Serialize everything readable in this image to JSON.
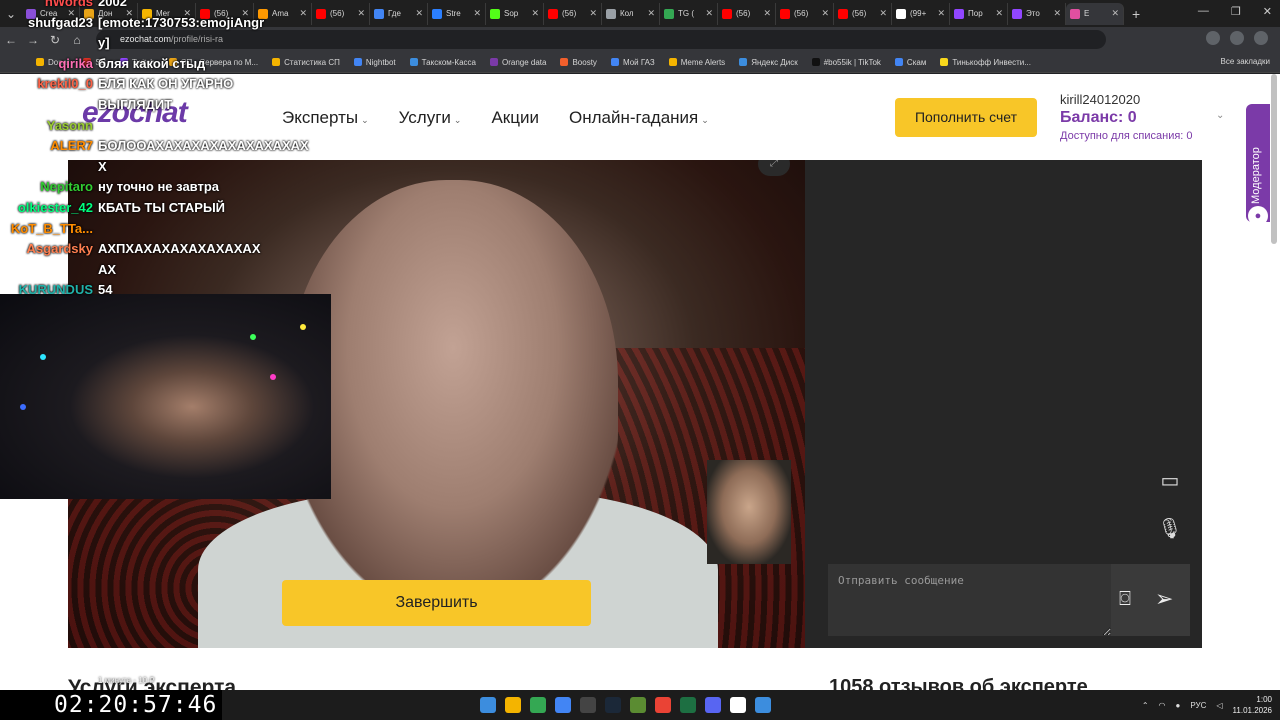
{
  "browser": {
    "tabs": [
      {
        "label": "Crea",
        "color": "#8a4fd8"
      },
      {
        "label": "Дон",
        "color": "#e8a317"
      },
      {
        "label": "Mer",
        "color": "#f4b400"
      },
      {
        "label": "(56)",
        "color": "#ff0000"
      },
      {
        "label": "Ama",
        "color": "#ff9900"
      },
      {
        "label": "(56)",
        "color": "#ff0000"
      },
      {
        "label": "Где",
        "color": "#4285f4"
      },
      {
        "label": "Stre",
        "color": "#2b7fff"
      },
      {
        "label": "Sop",
        "color": "#53fc18"
      },
      {
        "label": "(56)",
        "color": "#ff0000"
      },
      {
        "label": "Кол",
        "color": "#9aa0a6"
      },
      {
        "label": "TG (",
        "color": "#34a853"
      },
      {
        "label": "(56)",
        "color": "#ff0000"
      },
      {
        "label": "(56)",
        "color": "#ff0000"
      },
      {
        "label": "(56)",
        "color": "#ff0000"
      },
      {
        "label": "(99+",
        "color": "#ffffff"
      },
      {
        "label": "Пор",
        "color": "#9146ff"
      },
      {
        "label": "Это",
        "color": "#9146ff"
      },
      {
        "label": "E",
        "color": "#e04fa0"
      }
    ],
    "url_host": "ezochat.com",
    "url_path": "/profile/risi-ra",
    "bookmarks": [
      {
        "label": "Donat",
        "color": "#f4b400"
      },
      {
        "label": "SB",
        "color": "#d93025"
      },
      {
        "label": "Twitch",
        "color": "#9146ff"
      },
      {
        "label": "СП - Сервера по М...",
        "color": "#e8a317"
      },
      {
        "label": "Статистика СП",
        "color": "#f4b400"
      },
      {
        "label": "Nightbot",
        "color": "#4285f4"
      },
      {
        "label": "Такском-Касса",
        "color": "#3c8dde"
      },
      {
        "label": "Orange data",
        "color": "#7b3aa8"
      },
      {
        "label": "Boosty",
        "color": "#f15f2c"
      },
      {
        "label": "Мой ГАЗ",
        "color": "#4285f4"
      },
      {
        "label": "Meme Alerts",
        "color": "#f4b400"
      },
      {
        "label": "Яндекс Диск",
        "color": "#3c8dde"
      },
      {
        "label": "#bo55ik | TikTok",
        "color": "#111111"
      },
      {
        "label": "Скам",
        "color": "#4285f4"
      },
      {
        "label": "Тинькофф Инвести...",
        "color": "#f8d81c"
      }
    ],
    "all_bookmarks": "Все закладки"
  },
  "site": {
    "logo": "ezochat",
    "nav": [
      "Эксперты",
      "Услуги",
      "Акции",
      "Онлайн-гадания"
    ],
    "topup_label": "Пополнить счет",
    "username": "kirill24012020",
    "balance": "Баланс: 0",
    "available": "Доступно для списания: 0",
    "end_call_label": "Завершить",
    "message_placeholder": "Отправить сообщение",
    "moderator_label": "Модератор",
    "services_title": "Услуги эксперта",
    "reviews_title": "1058 отзывов об эксперте"
  },
  "stream": {
    "chat": [
      {
        "nick": "nWords",
        "msg": "2002",
        "color": "#ff4d4d"
      },
      {
        "nick": "shufgad23",
        "msg": "[emote:1730753:emojiAngr",
        "color": "#ffffff"
      },
      {
        "nick": "",
        "msg": "y]",
        "color": "#ffffff"
      },
      {
        "nick": "qirika",
        "msg": "бляя какой стыд",
        "color": "#ff6fb5"
      },
      {
        "nick": "krekil0_0",
        "msg": "БЛЯ КАК ОН УГАРНО",
        "color": "#ff6347"
      },
      {
        "nick": "",
        "msg": "ВЫГЛЯДИТ",
        "color": "#ffffff"
      },
      {
        "nick": "Yasonn",
        "msg": "",
        "color": "#9acd32"
      },
      {
        "nick": "ALER7",
        "msg": "БОЛООАХАХАХАХАХАХАХАХАХ",
        "color": "#ff8c00"
      },
      {
        "nick": "",
        "msg": "Х",
        "color": "#ffffff"
      },
      {
        "nick": "Nepitaro",
        "msg": "ну точно не завтра",
        "color": "#32cd32"
      },
      {
        "nick": "olkiester_42",
        "msg": "КБАТЬ ТЫ СТАРЫЙ",
        "color": "#00ff7f"
      },
      {
        "nick": "KoT_B_TTa...",
        "msg": "",
        "color": "#ff8c00"
      },
      {
        "nick": "Asgardsky",
        "msg": "АХПХАХАХАХАХАХАХАХ",
        "color": "#ff7f50"
      },
      {
        "nick": "",
        "msg": "АХ",
        "color": "#ffffff"
      },
      {
        "nick": "KURUNDUS",
        "msg": "54",
        "color": "#20b2aa"
      }
    ],
    "timer": "02:20:57:46",
    "timer_sub": "1 минута - 10 ₽"
  },
  "taskbar": {
    "icons": [
      {
        "name": "windows-start-icon",
        "color": "#3c8dde"
      },
      {
        "name": "file-explorer-icon",
        "color": "#f4b400"
      },
      {
        "name": "chrome-icon",
        "color": "#34a853"
      },
      {
        "name": "app-icon",
        "color": "#4285f4"
      },
      {
        "name": "obs-icon",
        "color": "#444444"
      },
      {
        "name": "steam-icon",
        "color": "#1b2838"
      },
      {
        "name": "minecraft-icon",
        "color": "#5b8c32"
      },
      {
        "name": "chrome-alt-icon",
        "color": "#ea4335"
      },
      {
        "name": "excel-icon",
        "color": "#1d6f42"
      },
      {
        "name": "discord-icon",
        "color": "#5865f2"
      },
      {
        "name": "app2-icon",
        "color": "#ffffff"
      },
      {
        "name": "app3-icon",
        "color": "#3c8dde"
      }
    ],
    "lang": "РУС",
    "time": "1:00",
    "date": "11.01.2026"
  }
}
